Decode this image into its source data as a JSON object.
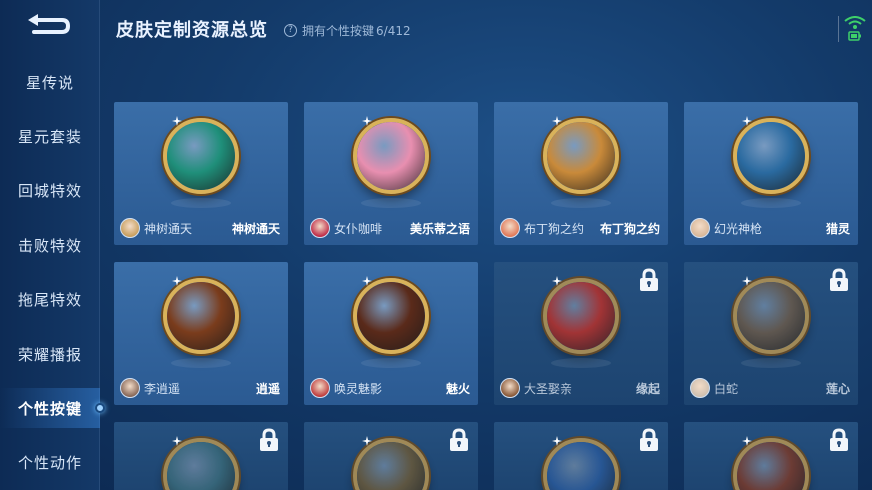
{
  "header": {
    "title": "皮肤定制资源总览",
    "owned_label": "拥有个性按键",
    "owned_count": "6/412"
  },
  "sidebar": {
    "items": [
      {
        "label": "星传说"
      },
      {
        "label": "星元套装"
      },
      {
        "label": "回城特效"
      },
      {
        "label": "击败特效"
      },
      {
        "label": "拖尾特效"
      },
      {
        "label": "荣耀播报"
      },
      {
        "label": "个性按键"
      },
      {
        "label": "个性动作"
      }
    ],
    "active_index": 6
  },
  "cards": [
    {
      "hero": "神树通天",
      "skin": "神树通天",
      "locked": false,
      "medal_color": "#1f8f7a",
      "avatar_color": "#c8a060"
    },
    {
      "hero": "女仆咖啡",
      "skin": "美乐蒂之语",
      "locked": false,
      "medal_color": "#e88fb0",
      "avatar_color": "#c0304a"
    },
    {
      "hero": "布丁狗之约",
      "skin": "布丁狗之约",
      "locked": false,
      "medal_color": "#c98a3a",
      "avatar_color": "#e07a5a"
    },
    {
      "hero": "幻光神枪",
      "skin": "猎灵",
      "locked": false,
      "medal_color": "#2a6aa0",
      "avatar_color": "#d8b89a"
    },
    {
      "hero": "李逍遥",
      "skin": "逍遥",
      "locked": false,
      "medal_color": "#7a3c1c",
      "avatar_color": "#8a6a5a"
    },
    {
      "hero": "唤灵魅影",
      "skin": "魅火",
      "locked": false,
      "medal_color": "#5a2a1a",
      "avatar_color": "#c04040"
    },
    {
      "hero": "大圣娶亲",
      "skin": "缘起",
      "locked": true,
      "medal_color": "#b8302a",
      "avatar_color": "#8a5a3a"
    },
    {
      "hero": "白蛇",
      "skin": "莲心",
      "locked": true,
      "medal_color": "#6a5a4a",
      "avatar_color": "#d0c0b0"
    },
    {
      "locked": true,
      "medal_color": "#3a6a7a"
    },
    {
      "locked": true,
      "medal_color": "#6a5a3a"
    },
    {
      "locked": true,
      "medal_color": "#2a5a9a"
    },
    {
      "locked": true,
      "medal_color": "#7a3a2a"
    }
  ],
  "icons": {
    "back": "back-arrow-icon",
    "help": "question-circle-icon",
    "lock": "lock-icon",
    "wifi": "wifi-icon",
    "battery": "battery-icon"
  }
}
